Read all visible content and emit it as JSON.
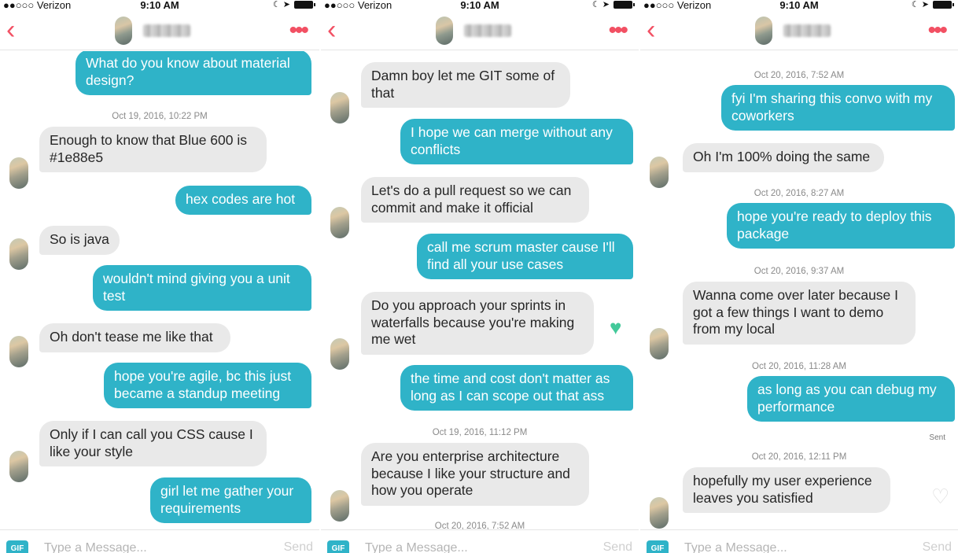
{
  "status_bar": {
    "carrier": "●●○○○ Verizon",
    "time": "9:10 AM",
    "signal": "☾ ➤"
  },
  "chat": {
    "contact_name": "Jessica",
    "composer": {
      "gif_label": "GIF",
      "placeholder": "Type a Message...",
      "send_label": "Send"
    }
  },
  "panels": [
    {
      "messages": [
        {
          "kind": "out",
          "text": "What do you know about material design?"
        },
        {
          "kind": "stamp",
          "text": "Oct 19, 2016, 10:22 PM"
        },
        {
          "kind": "in",
          "text": "Enough to know that Blue 600 is #1e88e5"
        },
        {
          "kind": "out",
          "text": "hex codes are hot"
        },
        {
          "kind": "in",
          "text": "So is java"
        },
        {
          "kind": "out",
          "text": "wouldn't mind giving you a unit test"
        },
        {
          "kind": "in",
          "text": "Oh don't tease me like that"
        },
        {
          "kind": "out",
          "text": "hope you're agile, bc this just became a standup meeting"
        },
        {
          "kind": "in",
          "text": "Only if I can call you CSS cause I like your style"
        },
        {
          "kind": "out",
          "text": "girl let me gather your requirements"
        }
      ]
    },
    {
      "messages": [
        {
          "kind": "in",
          "text": "Damn boy let me GIT some of that"
        },
        {
          "kind": "out",
          "text": "I hope we can merge without any conflicts"
        },
        {
          "kind": "in",
          "text": "Let's do a pull request so we can commit and make it official"
        },
        {
          "kind": "out",
          "text": "call me scrum master cause I'll find all your use cases"
        },
        {
          "kind": "in",
          "text": "Do you approach your sprints in waterfalls because you're making me wet",
          "liked": true
        },
        {
          "kind": "out",
          "text": "the time and cost don't matter as long as I can scope out that ass"
        },
        {
          "kind": "stamp",
          "text": "Oct 19, 2016, 11:12 PM"
        },
        {
          "kind": "in",
          "text": "Are you enterprise architecture because I like your structure and how you operate"
        },
        {
          "kind": "stamp",
          "text": "Oct 20, 2016, 7:52 AM"
        }
      ]
    },
    {
      "messages": [
        {
          "kind": "stamp",
          "text": "Oct 20, 2016, 7:52 AM"
        },
        {
          "kind": "out",
          "text": "fyi I'm sharing this convo with my coworkers"
        },
        {
          "kind": "in",
          "text": "Oh I'm 100% doing the same"
        },
        {
          "kind": "stamp",
          "text": "Oct 20, 2016, 8:27 AM"
        },
        {
          "kind": "out",
          "text": "hope you're ready to deploy this package"
        },
        {
          "kind": "stamp",
          "text": "Oct 20, 2016, 9:37 AM"
        },
        {
          "kind": "in",
          "text": "Wanna come over later because I got a few things I want to demo from my local"
        },
        {
          "kind": "stamp",
          "text": "Oct 20, 2016, 11:28 AM"
        },
        {
          "kind": "out",
          "text": "as long as you can debug my performance"
        },
        {
          "kind": "sent",
          "text": "Sent"
        },
        {
          "kind": "stamp",
          "text": "Oct 20, 2016, 12:11 PM"
        },
        {
          "kind": "in",
          "text": "hopefully my user experience leaves you satisfied",
          "liked": false
        }
      ]
    }
  ],
  "colors": {
    "accent": "#f25063",
    "outgoing": "#2fb3c8",
    "incoming": "#e9e9e9",
    "like": "#43c99a"
  },
  "icons": {
    "back": "chevron-left-icon",
    "more": "more-dots-icon",
    "like_filled": "heart-filled-icon",
    "like_empty": "heart-outline-icon"
  }
}
